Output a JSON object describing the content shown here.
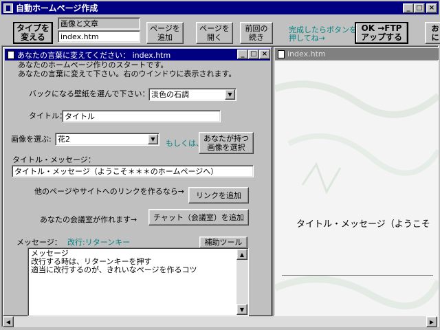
{
  "app": {
    "title": "自動ホームページ作成",
    "icon": "app-icon"
  },
  "toolbar": {
    "type_button": "タイプを\n変える",
    "mode_field": "画像と文章",
    "file_field": "index.htm",
    "add_page": "ページを\n追加",
    "open_page": "ページを\n開く",
    "resume": "前回の\n続き",
    "hint": "完成したらボタンを\n押してね→",
    "ftp_button": "OK →FTP\nアップする",
    "cut_button": "お\nに"
  },
  "editor": {
    "title": "あなたの言葉に変えてください： index.htm",
    "intro_line1": "あなたのホームページ作りのスタートです。",
    "intro_line2": "あなたの言葉に変えて下さい。右のウインドウに表示されます。",
    "wallpaper_label": "バックになる壁紙を選んで下さい：",
    "wallpaper_value": "淡色の石調",
    "title_label": "タイトル：",
    "title_value": "タイトル",
    "image_label": "画像を選ぶ:",
    "image_value": "花2",
    "or_label": "もしくは、",
    "own_image_button": "あなたが持つ\n画像を選択",
    "title_message_label": "タイトル・メッセージ：",
    "title_message_value": "タイトル・メッセージ（ようこそ＊＊＊のホームページへ）",
    "link_label": "他のページやサイトへのリンクを作るなら→",
    "add_link_button": "リンクを追加",
    "chat_label": "あなたの会議室が作れます→",
    "add_chat_button": "チャット（会議室）を追加",
    "message_label": "メッセージ：",
    "newline_hint": "改行:リターンキー",
    "assist_button": "補助ツール",
    "message_lines": [
      "メッセージ",
      "改行する時は、リターンキーを押す",
      "適当に改行するのが、きれいなページを作るコツ"
    ]
  },
  "preview": {
    "title": "index.htm",
    "display_text": "タイトル・メッセージ（ようこそ"
  }
}
